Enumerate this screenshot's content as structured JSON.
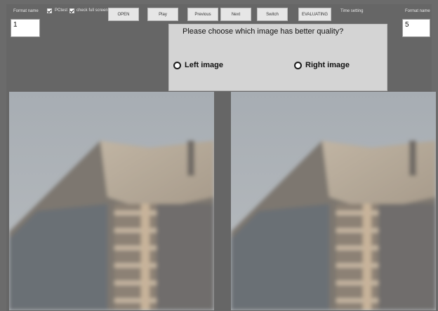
{
  "toolbar": {
    "format_name_left": "Format name",
    "pctest_label": "PCtest",
    "fullscreen_label": "check full screen",
    "buttons": {
      "open": "OPEN",
      "play": "Play",
      "previous": "Previous",
      "next": "Next",
      "switch": "Switch",
      "evaluating": "EVALUATING"
    },
    "time_setting": "Time setting",
    "format_name_right": "Format name",
    "left_value": "1",
    "right_value": "5",
    "pctest_checked": true,
    "fullscreen_checked": true
  },
  "dialog": {
    "question": "Please choose which image has better quality?",
    "options": {
      "left": "Left image",
      "right": "Right image"
    }
  },
  "images": {
    "left": "building-photo",
    "right": "building-photo"
  }
}
